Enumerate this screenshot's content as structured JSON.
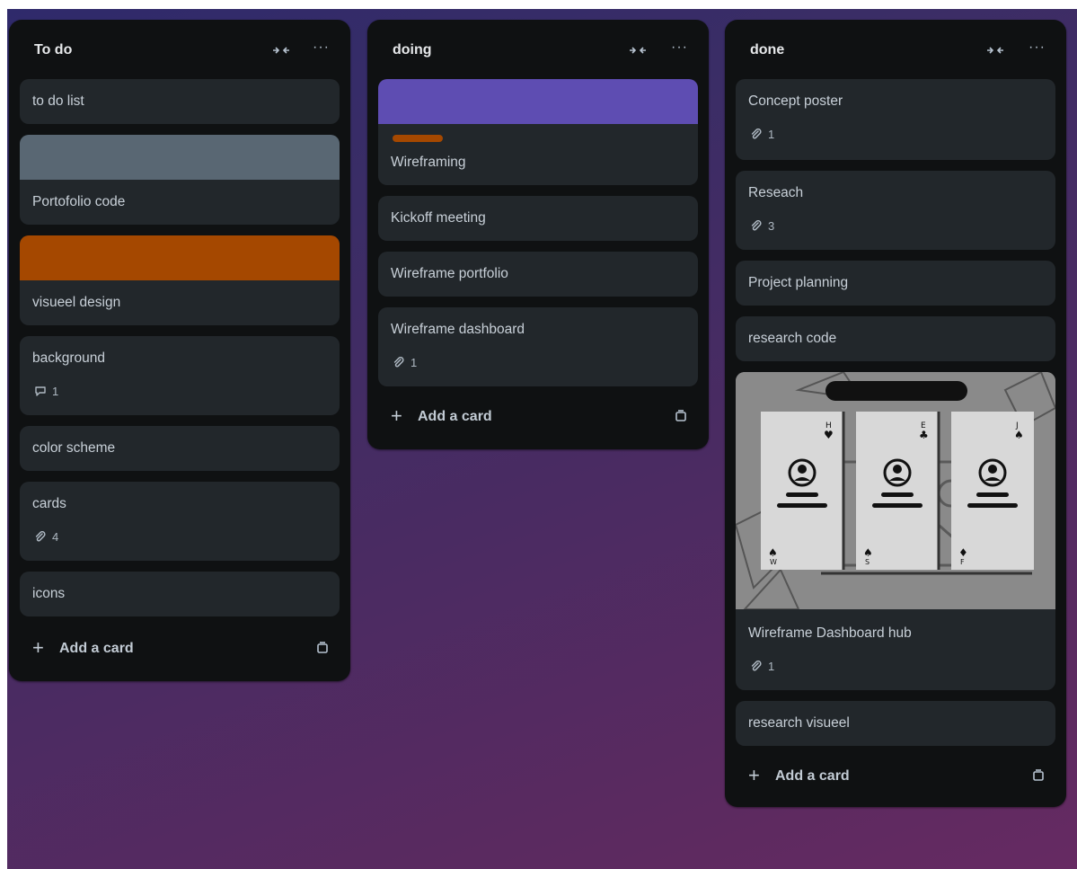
{
  "colors": {
    "board_top": "#2f2a6b",
    "board_bottom": "#662a62",
    "list_bg": "#0f1112",
    "card_bg": "#22272b",
    "cover_gray": "#596773",
    "cover_orange": "#a54800",
    "cover_purple": "#5e4db2",
    "label_orange": "#a54800"
  },
  "lists": [
    {
      "title": "To do",
      "cards": [
        {
          "title": "to do list"
        },
        {
          "title": "Portofolio code",
          "cover": "gray"
        },
        {
          "title": "visueel design",
          "cover": "orange"
        },
        {
          "title": "background",
          "badge_icon": "comment-icon",
          "badge_count": "1"
        },
        {
          "title": "color scheme"
        },
        {
          "title": "cards",
          "badge_icon": "attachment-icon",
          "badge_count": "4"
        },
        {
          "title": "icons"
        }
      ],
      "add_card": "Add a card"
    },
    {
      "title": "doing",
      "cards": [
        {
          "title": "Wireframing",
          "cover": "purple",
          "label": "orange"
        },
        {
          "title": "Kickoff meeting"
        },
        {
          "title": "Wireframe portfolio"
        },
        {
          "title": "Wireframe dashboard",
          "badge_icon": "attachment-icon",
          "badge_count": "1"
        }
      ],
      "add_card": "Add a card"
    },
    {
      "title": "done",
      "cards": [
        {
          "title": "Concept poster",
          "badge_icon": "attachment-icon",
          "badge_count": "1"
        },
        {
          "title": "Reseach",
          "badge_icon": "attachment-icon",
          "badge_count": "3"
        },
        {
          "title": "Project planning"
        },
        {
          "title": "research code"
        },
        {
          "title": "Wireframe Dashboard hub",
          "cover": "image",
          "badge_icon": "attachment-icon",
          "badge_count": "1"
        },
        {
          "title": "research visueel"
        }
      ],
      "add_card": "Add a card"
    }
  ]
}
